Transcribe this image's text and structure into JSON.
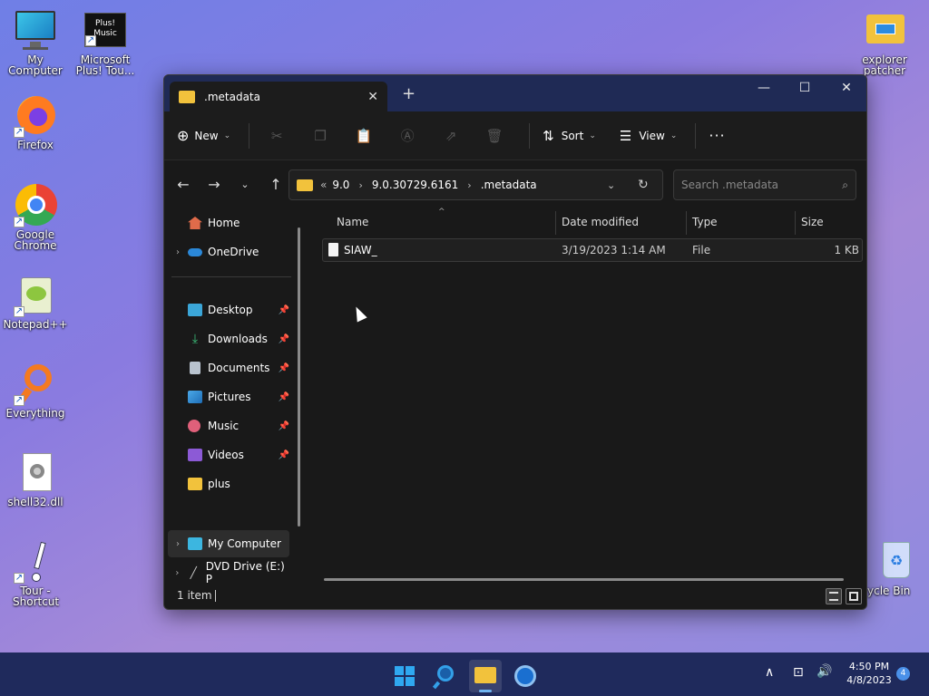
{
  "desktop": {
    "icons": [
      {
        "label": "My Computer",
        "icon": "monitor-icon"
      },
      {
        "label": "Microsoft Plus! Tou...",
        "icon": "plus-music-icon",
        "badge": "Plus! Music"
      },
      {
        "label": "Firefox",
        "icon": "firefox-icon"
      },
      {
        "label": "Google Chrome",
        "icon": "chrome-icon"
      },
      {
        "label": "Notepad++",
        "icon": "notepadpp-icon"
      },
      {
        "label": "Everything",
        "icon": "everything-icon"
      },
      {
        "label": "shell32.dll",
        "icon": "dll-file-icon"
      },
      {
        "label": "Tour - Shortcut",
        "icon": "tour-icon"
      },
      {
        "label": "explorer patcher",
        "icon": "folder-icon"
      },
      {
        "label": "ycle Bin",
        "icon": "recycle-bin-icon"
      }
    ]
  },
  "window": {
    "tab_title": ".metadata",
    "toolbar": {
      "new_label": "New",
      "sort_label": "Sort",
      "view_label": "View",
      "more_label": "···"
    },
    "breadcrumb": {
      "overflow": "«",
      "items": [
        "9.0",
        "9.0.30729.6161",
        ".metadata"
      ]
    },
    "search_placeholder": "Search .metadata",
    "sidebar": {
      "home": "Home",
      "onedrive": "OneDrive",
      "quick": [
        "Desktop",
        "Downloads",
        "Documents",
        "Pictures",
        "Music",
        "Videos",
        "plus"
      ],
      "my_computer": "My Computer",
      "dvd": "DVD Drive (E:) P"
    },
    "columns": {
      "name": "Name",
      "date": "Date modified",
      "type": "Type",
      "size": "Size"
    },
    "files": [
      {
        "name": "SIAW_",
        "date": "3/19/2023 1:14 AM",
        "type": "File",
        "size": "1 KB"
      }
    ],
    "status": "1 item"
  },
  "taskbar": {
    "time": "4:50 PM",
    "date": "4/8/2023",
    "notifications": "4"
  },
  "colors": {
    "folder": "#f2c23c",
    "accent": "#1f2a55",
    "window_bg": "#191919"
  }
}
